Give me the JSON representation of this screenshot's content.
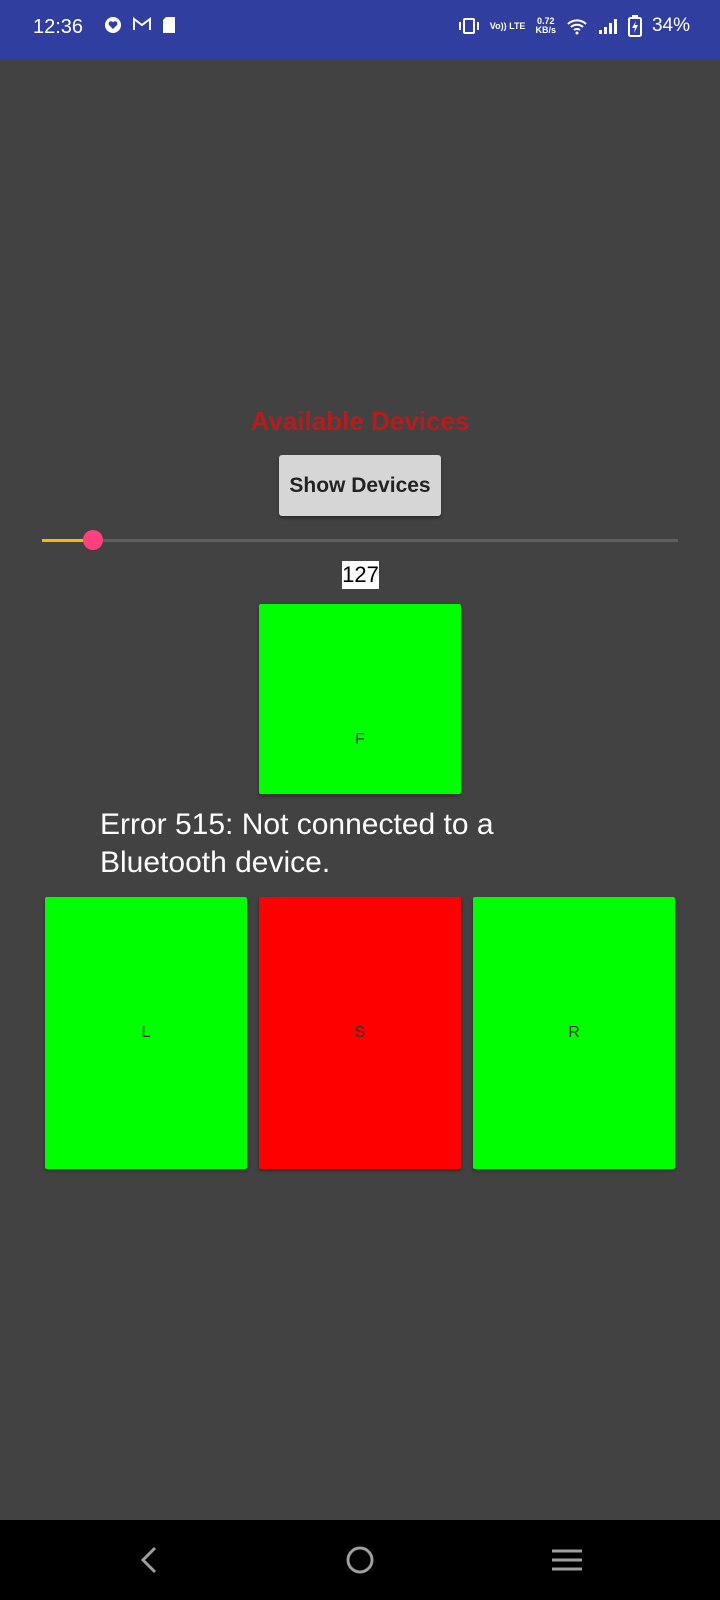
{
  "status_bar": {
    "time": "12:36",
    "notification_icons": [
      "heart-app-icon",
      "gmail-icon",
      "sd-card-icon"
    ],
    "volte": "Vo)) LTE",
    "speed_value": "0.72",
    "speed_unit": "KB/s",
    "battery": "34%"
  },
  "main": {
    "title": "Available Devices",
    "show_devices_label": "Show Devices",
    "slider": {
      "value": 127,
      "max": 1023,
      "fill_fraction": 0.08,
      "accent": "#f9b70b",
      "thumb_color": "#ff4081"
    },
    "value_label": "127",
    "forward_label": "F",
    "error_message": "Error 515: Not connected to a Bluetooth device.",
    "left_label": "L",
    "stop_label": "S",
    "right_label": "R"
  },
  "colors": {
    "status_bar": "#303f9f",
    "background": "#424242",
    "title": "#b71c1c",
    "go": "#00ff00",
    "stop": "#ff0000"
  },
  "nav_bar": {
    "icons": [
      "back-icon",
      "home-icon",
      "recents-icon"
    ]
  }
}
